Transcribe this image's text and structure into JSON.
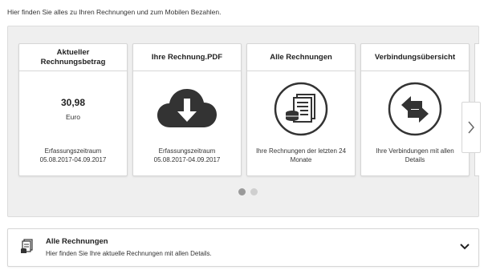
{
  "intro_text": "Hier finden Sie alles zu Ihren Rechnungen und zum Mobilen Bezahlen.",
  "cards": [
    {
      "title_line1": "Aktueller",
      "title_line2": "Rechnungsbetrag",
      "amount": "30,98",
      "unit": "Euro",
      "foot_line1": "Erfassungszeitraum",
      "foot_line2": "05.08.2017-04.09.2017"
    },
    {
      "title": "Ihre Rechnung.PDF",
      "icon": "cloud-download-icon",
      "foot_line1": "Erfassungszeitraum",
      "foot_line2": "05.08.2017-04.09.2017"
    },
    {
      "title": "Alle Rechnungen",
      "icon": "invoices-coins-icon",
      "foot_line1": "Ihre Rechnungen der letzten 24",
      "foot_line2": "Monate"
    },
    {
      "title": "Verbindungsübersicht",
      "icon": "swap-arrows-icon",
      "foot_line1": "Ihre Verbindungen mit allen",
      "foot_line2": "Details"
    }
  ],
  "carousel": {
    "next_icon": "chevron-right-icon",
    "page_count": 2,
    "active_page": 1
  },
  "accordion": {
    "title": "Alle Rechnungen",
    "subtitle": "Hier finden Sie Ihre aktuelle Rechnungen mit allen Details.",
    "icon": "invoices-icon",
    "toggle_icon": "chevron-down-icon"
  },
  "colors": {
    "icon_dark": "#333333",
    "panel_bg": "#efefef",
    "dot_active": "#9a9a9a",
    "dot_inactive": "#cfcfcf"
  }
}
